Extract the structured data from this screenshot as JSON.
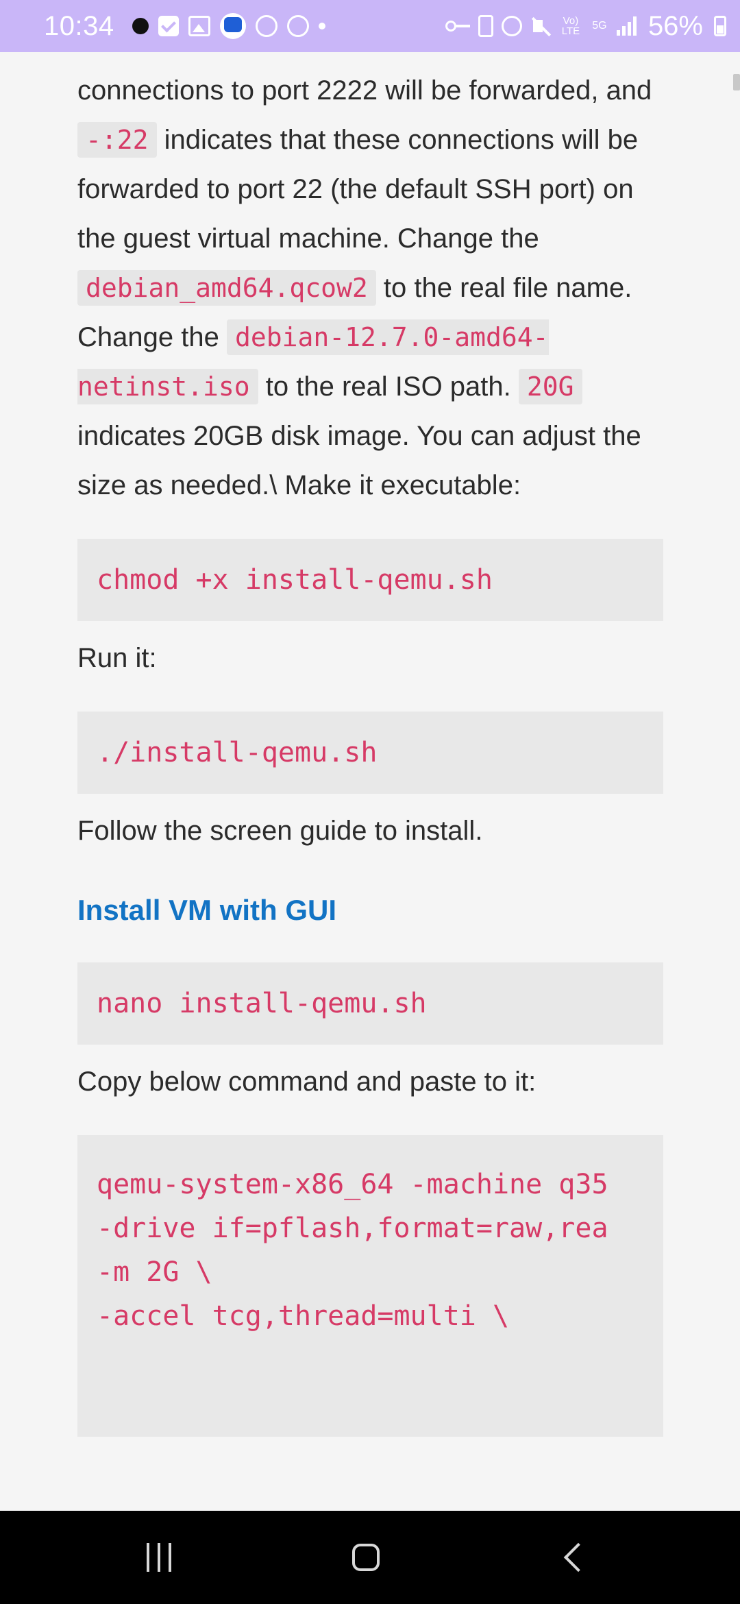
{
  "status_bar": {
    "time": "10:34",
    "battery": "56%",
    "volte_top": "Vo)",
    "volte_bottom": "LTE",
    "network": "5G"
  },
  "article": {
    "para1": {
      "t1": "connections to port 2222 will be forwarded, and ",
      "c1": "-:22",
      "t2": " indicates that these connections will be forwarded to port 22 (the default SSH port) on the guest virtual machine. Change the ",
      "c2": "debian_amd64.qcow2",
      "t3": " to the real file name. Change the ",
      "c3": "debian-12.7.0-amd64-netinst.iso",
      "t4": " to the real ISO path. ",
      "c4": "20G",
      "t5": " indicates 20GB disk image. You can adjust the size as needed.\\ Make it executable:"
    },
    "code_chmod": "chmod +x install-qemu.sh",
    "run_label": "Run it:",
    "code_run": "./install-qemu.sh",
    "follow_label": "Follow the screen guide to install.",
    "heading_gui": "Install VM with GUI",
    "code_nano": "nano install-qemu.sh",
    "copy_label": "Copy below command and paste to it:",
    "code_qemu": [
      "qemu-system-x86_64 -machine q35",
      "-drive if=pflash,format=raw,rea",
      "-m 2G \\",
      "-accel tcg,thread=multi \\"
    ]
  }
}
